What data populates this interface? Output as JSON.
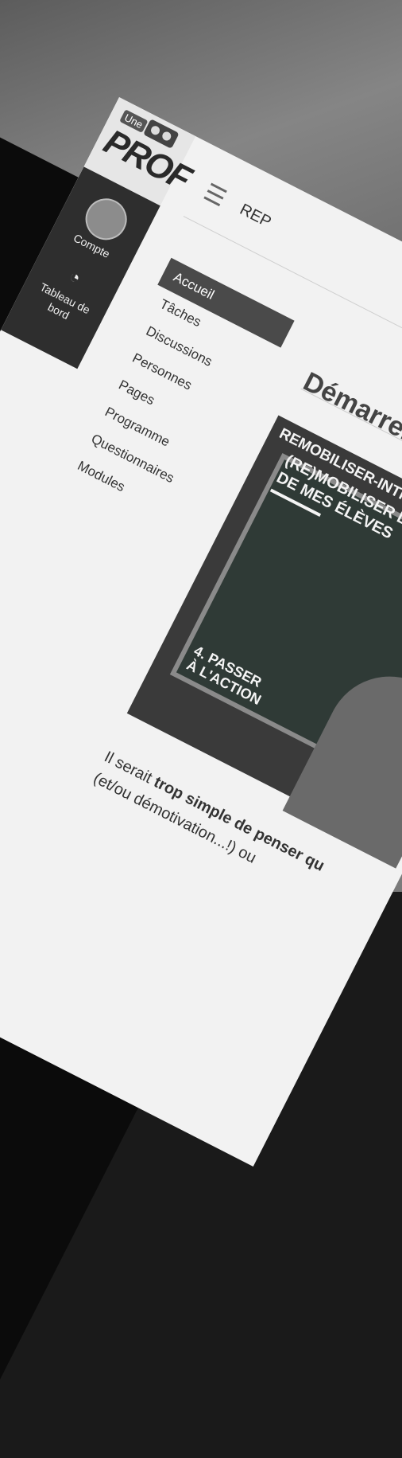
{
  "brand": {
    "small": "Une",
    "main": "PROF"
  },
  "topbar": {
    "title": "REP"
  },
  "side": {
    "account": "Compte",
    "dashboard_l1": "Tableau de",
    "dashboard_l2": "bord"
  },
  "nav": {
    "items": [
      {
        "label": "Accueil",
        "active": true
      },
      {
        "label": "Tâches"
      },
      {
        "label": "Discussions"
      },
      {
        "label": "Personnes"
      },
      {
        "label": "Pages"
      },
      {
        "label": "Programme"
      },
      {
        "label": "Questionnaires"
      },
      {
        "label": "Modules"
      }
    ]
  },
  "main": {
    "title": "Démarrer e",
    "video": {
      "line1": "REMOBILISER-INTRO",
      "line2": "(RE)MOBILISER L'ATT",
      "line3": "DE MES ÉLÈVES",
      "step_l1": "4. PASSER",
      "step_l2": "À L'ACTION"
    },
    "text_l1_prefix": "Il serait ",
    "text_l1_bold": "trop simple de penser qu",
    "text_l2": "(et/ou démotivation...!) ou"
  }
}
